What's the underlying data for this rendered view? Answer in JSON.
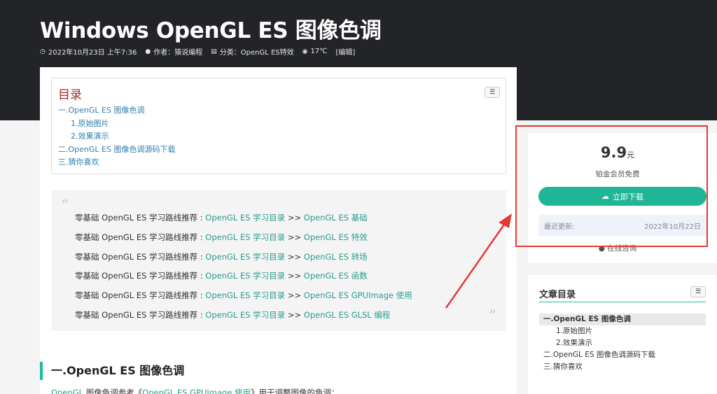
{
  "header": {
    "title": "Windows OpenGL ES 图像色调",
    "meta": {
      "date": "2022年10月23日 上午7:36",
      "author": "作者：猿说编程",
      "category": "分类：OpenGL ES特效",
      "views": "17℃",
      "edit": "[编辑]"
    }
  },
  "toc": {
    "title": "目录",
    "toggle_icon": "list-icon",
    "items": [
      {
        "label": "一.OpenGL ES 图像色调"
      },
      {
        "label": "1.原始图片"
      },
      {
        "label": "2.效果演示"
      },
      {
        "label": "二.OpenGL ES 图像色调源码下载"
      },
      {
        "label": "三.猜你喜欢"
      }
    ]
  },
  "quote": {
    "lines": [
      {
        "prefix": "零基础 OpenGL ES 学习路线推荐 : ",
        "link1": "OpenGL ES 学习目录",
        "sep": " >> ",
        "link2": "OpenGL ES 基础"
      },
      {
        "prefix": "零基础 OpenGL ES 学习路线推荐 : ",
        "link1": "OpenGL ES 学习目录",
        "sep": "  >> ",
        "link2": "OpenGL ES 特效"
      },
      {
        "prefix": "零基础 OpenGL ES 学习路线推荐 : ",
        "link1": "OpenGL ES 学习目录",
        "sep": "  >> ",
        "link2": "OpenGL ES 转场"
      },
      {
        "prefix": "零基础 OpenGL ES 学习路线推荐 :  ",
        "link1": "OpenGL ES 学习目录",
        "sep": " >> ",
        "link2": "OpenGL ES 函数"
      },
      {
        "prefix": "零基础 OpenGL ES 学习路线推荐 :  ",
        "link1": "OpenGL ES 学习目录",
        "sep": " >> ",
        "link2": "OpenGL ES GPUImage 使用"
      },
      {
        "prefix": "零基础 OpenGL ES 学习路线推荐 :  ",
        "link1": "OpenGL ES 学习目录",
        "sep": " >> ",
        "link2": "OpenGL ES GLSL 编程"
      }
    ]
  },
  "section": {
    "heading": "一.OpenGL ES 图像色调",
    "para_link1": "OpenGL",
    "para_text1": " 图像色调参考《",
    "para_link2": "OpenGL ES GPUImage 使用",
    "para_text2": "》用于调整图像的色调；"
  },
  "sidebar": {
    "price": "9.9",
    "price_unit": "元",
    "price_note": "铂金会员免费",
    "download_label": "立即下载",
    "update_label": "最近更新:",
    "update_date": "2022年10月22日",
    "consult_label": "在线咨询",
    "toc_title": "文章目录",
    "toc_items": [
      {
        "label": "一.OpenGL ES 图像色调"
      },
      {
        "label": "1.原始图片"
      },
      {
        "label": "2.效果演示"
      },
      {
        "label": "二.OpenGL ES 图像色调源码下载"
      },
      {
        "label": "三.猜你喜欢"
      }
    ]
  },
  "colors": {
    "accent": "#1fb597",
    "header_bg": "#232427",
    "annotation": "#e53935"
  }
}
